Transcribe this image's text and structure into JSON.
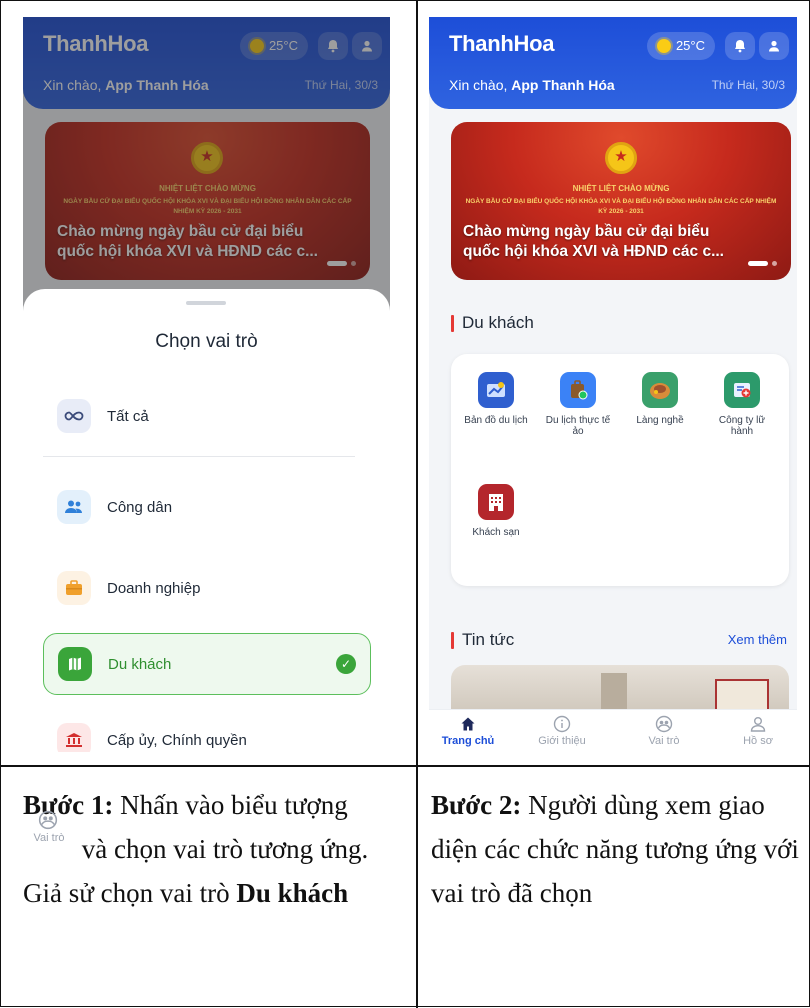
{
  "header": {
    "brand": "ThanhHoa",
    "temperature": "25°C",
    "greeting_prefix": "Xin chào, ",
    "greeting_name": "App Thanh Hóa",
    "date": "Thứ Hai, 30/3"
  },
  "banner": {
    "line1": "NHIỆT LIỆT CHÀO MỪNG",
    "line2": "NGÀY BẦU CỬ ĐẠI BIỂU QUỐC HỘI KHÓA XVI VÀ ĐẠI BIỂU HỘI ĐỒNG NHÂN DÂN CÁC CẤP NHIỆM KỲ 2026 - 2031",
    "caption": "Chào mừng ngày bầu cử đại biểu quốc hội khóa XVI và HĐND các c..."
  },
  "role_sheet": {
    "title": "Chọn vai trò",
    "roles": [
      {
        "label": "Tất cả",
        "icon": "infinity-icon"
      },
      {
        "label": "Công dân",
        "icon": "users-icon"
      },
      {
        "label": "Doanh nghiệp",
        "icon": "briefcase-icon"
      },
      {
        "label": "Du khách",
        "icon": "map-icon",
        "selected": true
      },
      {
        "label": "Cấp ủy, Chính quyền",
        "icon": "government-building-icon"
      }
    ]
  },
  "tourist_section": {
    "title": "Du khách",
    "features": [
      {
        "label": "Bản đồ du lịch",
        "icon": "travel-map-icon",
        "color": "#2f5fcf"
      },
      {
        "label": "Du lịch thực tế ảo",
        "icon": "luggage-icon",
        "color": "#3b82f6"
      },
      {
        "label": "Làng nghề",
        "icon": "craft-village-icon",
        "color": "#3aa06b"
      },
      {
        "label": "Công ty lữ hành",
        "icon": "travel-agency-icon",
        "color": "#2c9a6b"
      },
      {
        "label": "Khách sạn",
        "icon": "hotel-icon",
        "color": "#b4262c"
      }
    ]
  },
  "news_section": {
    "title": "Tin tức",
    "more": "Xem thêm"
  },
  "tabbar": {
    "tabs": [
      {
        "label": "Trang chủ",
        "icon": "home-icon",
        "active": true
      },
      {
        "label": "Giới thiệu",
        "icon": "info-icon"
      },
      {
        "label": "Vai trò",
        "icon": "role-icon"
      },
      {
        "label": "Hồ sơ",
        "icon": "profile-icon"
      }
    ]
  },
  "captions": {
    "step1_label": "Bước 1:",
    "step1_text_a": " Nhấn vào biểu tượng ",
    "step1_icon_label": "Vai trò",
    "step1_text_b": " và chọn vai trò tương ứng. Giả sử chọn vai trò ",
    "step1_bold": "Du khách",
    "step2_label": "Bước 2:",
    "step2_text": " Người dùng xem giao diện các chức năng tương ứng với vai trò đã chọn"
  },
  "colors": {
    "header_blue": "#1d4ed8",
    "accent_red": "#e53935",
    "selected_green": "#3aa53a"
  }
}
